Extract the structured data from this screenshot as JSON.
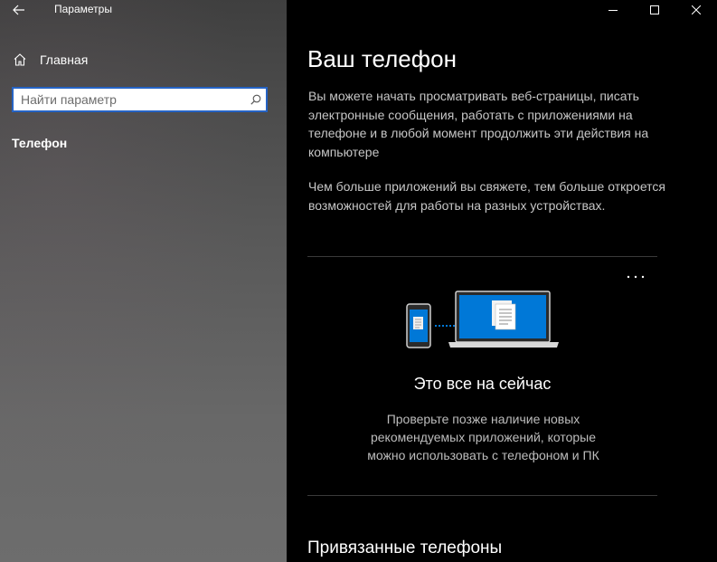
{
  "app": {
    "title": "Параметры"
  },
  "sidebar": {
    "home_label": "Главная",
    "search": {
      "placeholder": "Найти параметр",
      "value": ""
    },
    "section_label": "Телефон"
  },
  "main": {
    "page_title": "Ваш телефон",
    "description_1": "Вы можете начать просматривать веб-страницы, писать электронные сообщения, работать с приложениями на телефоне и в любой момент продолжить эти действия на компьютере",
    "description_2": "Чем больше приложений вы свяжете, тем больше откроется возможностей для работы на разных устройствах.",
    "card": {
      "more_label": "···",
      "title": "Это все на сейчас",
      "description": "Проверьте позже наличие новых рекомендуемых приложений, которые можно использовать с телефоном и ПК"
    },
    "linked_phones_title": "Привязанные телефоны"
  },
  "colors": {
    "accent": "#0078d7",
    "search_border": "#2563c4",
    "content_bg": "#000000"
  },
  "icons": {
    "back": "back-arrow-icon",
    "home": "home-icon",
    "search": "search-icon",
    "minimize": "minimize-icon",
    "maximize": "maximize-icon",
    "close": "close-icon",
    "more": "more-icon",
    "illustration": "phone-pc-illustration"
  }
}
